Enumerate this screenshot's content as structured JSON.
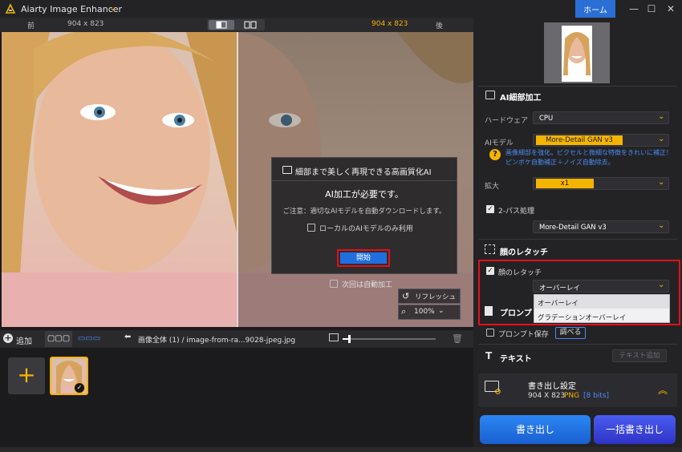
{
  "app": {
    "title": "Aiarty Image Enhancer",
    "home_label": "ホーム",
    "min": "—",
    "max": "☐",
    "close": "✕"
  },
  "compare": {
    "before_label": "前",
    "before_size": "904 x 823",
    "after_size": "904 x 823",
    "after_label": "後"
  },
  "dialog": {
    "heading": "細部まで美しく再現できる高画質化AI",
    "title": "AI加工が必要です。",
    "note": "ご注意：適切なAIモデルを自動ダウンロードします。",
    "local_only_label": "ローカルのAIモデルのみ利用",
    "start_label": "開始",
    "auto_label": "次回は自動加工"
  },
  "view_controls": {
    "refresh_label": "リフレッシュ",
    "zoom_value": "100%"
  },
  "bottom_bar": {
    "add_label": "追加",
    "grid_1": "▢▢▢",
    "grid_2": "▭▭▭",
    "breadcrumb": "画像全体 (1)  /  image-from-ra...9028-jpeg.jpg"
  },
  "panel": {
    "ai_section_title": "AI細部加工",
    "hardware_label": "ハードウェア",
    "hardware_value": "CPU",
    "model_label": "AIモデル",
    "model_value": "More-Detail GAN  v3",
    "help_line_1": "画像細部を強化。ピクセルと微細な特徴をきれいに補正！",
    "help_line_2": "ピンボケ自動補正＋ノイズ自動除去。",
    "scale_label": "拡大",
    "scale_value": "x1",
    "two_pass_label": "2-パス処理",
    "two_pass_model": "More-Detail GAN  v3",
    "face_section_title": "顔のレタッチ",
    "face_check_label": "顔のレタッチ",
    "face_mode_value": "オーバーレイ",
    "face_mode_options": [
      "オーバーレイ",
      "グラデーションオーバーレイ"
    ],
    "prompt_title": "プロンプ",
    "prompt_save_label": "プロンプト保存",
    "search_label": "調べる",
    "text_section_title": "テキスト",
    "text_add_label": "テキスト追加",
    "export_title": "書き出し設定",
    "export_size": "904 X 823",
    "export_format": "PNG",
    "export_bits": "[8 bits]",
    "export_label": "書き出し",
    "batch_export_label": "一括書き出し"
  },
  "colors": {
    "accent": "#f5b400",
    "primary_blue": "#1f6fe0",
    "highlight_red": "#e3101a"
  }
}
